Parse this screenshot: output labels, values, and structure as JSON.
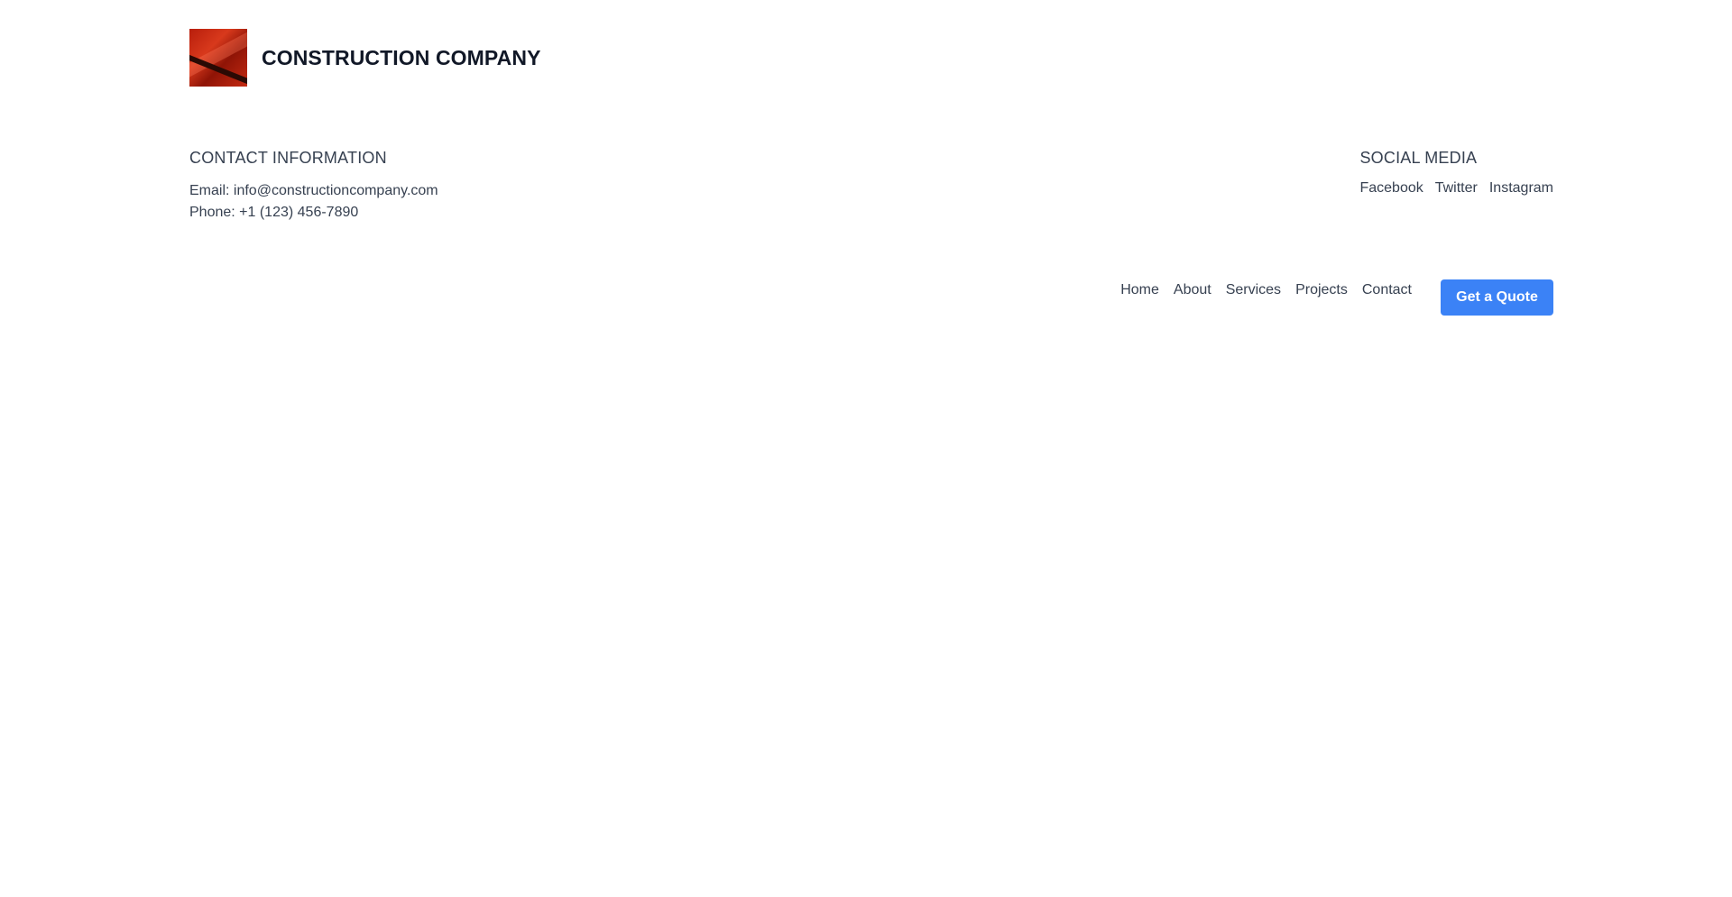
{
  "brand": {
    "name": "CONSTRUCTION COMPANY",
    "logo_icon": "brick-logo-icon"
  },
  "contact": {
    "title": "CONTACT INFORMATION",
    "email": "Email: info@constructioncompany.com",
    "phone": "Phone: +1 (123) 456-7890"
  },
  "social": {
    "title": "SOCIAL MEDIA",
    "links": [
      "Facebook",
      "Twitter",
      "Instagram"
    ]
  },
  "nav": {
    "items": [
      "Home",
      "About",
      "Services",
      "Projects",
      "Contact"
    ],
    "cta_label": "Get a Quote"
  },
  "colors": {
    "accent": "#3b82f6",
    "text": "#374151",
    "heading": "#111827"
  }
}
